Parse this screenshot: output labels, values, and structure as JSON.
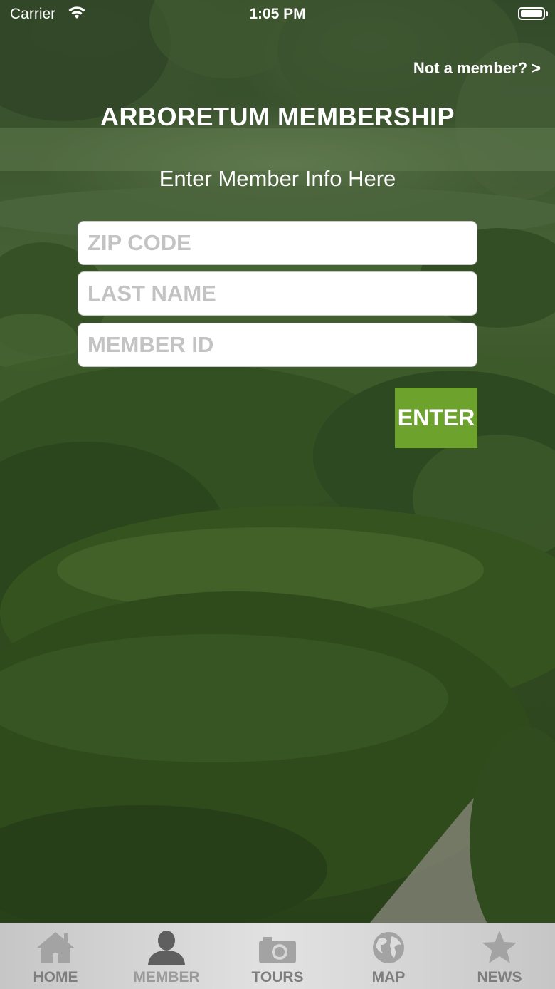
{
  "status_bar": {
    "carrier": "Carrier",
    "time": "1:05 PM"
  },
  "header": {
    "not_member_link": "Not a member? >",
    "title": "ARBORETUM MEMBERSHIP",
    "subtitle": "Enter Member Info Here"
  },
  "form": {
    "zip_placeholder": "ZIP CODE",
    "last_name_placeholder": "LAST NAME",
    "member_id_placeholder": "MEMBER ID",
    "enter_label": "ENTER",
    "enter_color": "#6da22c"
  },
  "tabbar": {
    "tabs": [
      {
        "label": "HOME",
        "icon": "house-icon"
      },
      {
        "label": "MEMBER",
        "icon": "person-icon",
        "active": true
      },
      {
        "label": "TOURS",
        "icon": "camera-icon"
      },
      {
        "label": "MAP",
        "icon": "globe-icon"
      },
      {
        "label": "NEWS",
        "icon": "star-icon"
      }
    ]
  }
}
